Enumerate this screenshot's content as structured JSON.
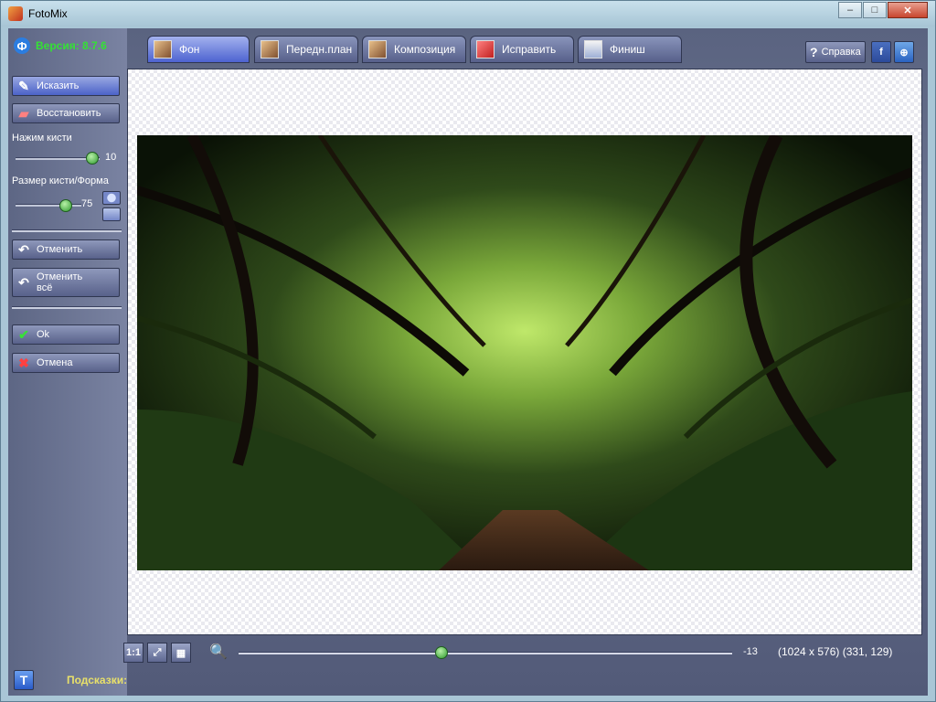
{
  "window": {
    "title": "FotoMix",
    "minimize": "–",
    "maximize": "□",
    "close": "✕"
  },
  "sidebar": {
    "version_icon": "Ф",
    "version_text": "Версия: 8.7.6",
    "distort_label": "Исказить",
    "restore_label": "Восстановить",
    "pressure_label": "Нажим кисти",
    "pressure_value": "10",
    "pressure_level": 0.9,
    "size_label": "Размер кисти/Форма",
    "size_value": "75",
    "size_level": 0.75,
    "undo_label": "Отменить",
    "undo_all_label": "Отменить всё",
    "ok_label": "Ok",
    "cancel_label": "Отмена"
  },
  "tabs": [
    {
      "label": "Фон",
      "active": true
    },
    {
      "label": "Передн.план",
      "active": false
    },
    {
      "label": "Композиция",
      "active": false
    },
    {
      "label": "Исправить",
      "active": false
    },
    {
      "label": "Финиш",
      "active": false
    }
  ],
  "toolbar": {
    "help_label": "Справка",
    "facebook_glyph": "f",
    "web_glyph": "⊕"
  },
  "bottom": {
    "btn_1to1": "1:1",
    "zoom_value": "-13",
    "zoom_level": 0.41,
    "image_info": "(1024 x 576) (331, 129)"
  },
  "hints": {
    "label": "Подсказки:",
    "button_glyph": "T"
  },
  "colors": {
    "version_green": "#34e234",
    "hint_yellow": "#e8e06a",
    "accent_blue": "#4d63d0"
  }
}
